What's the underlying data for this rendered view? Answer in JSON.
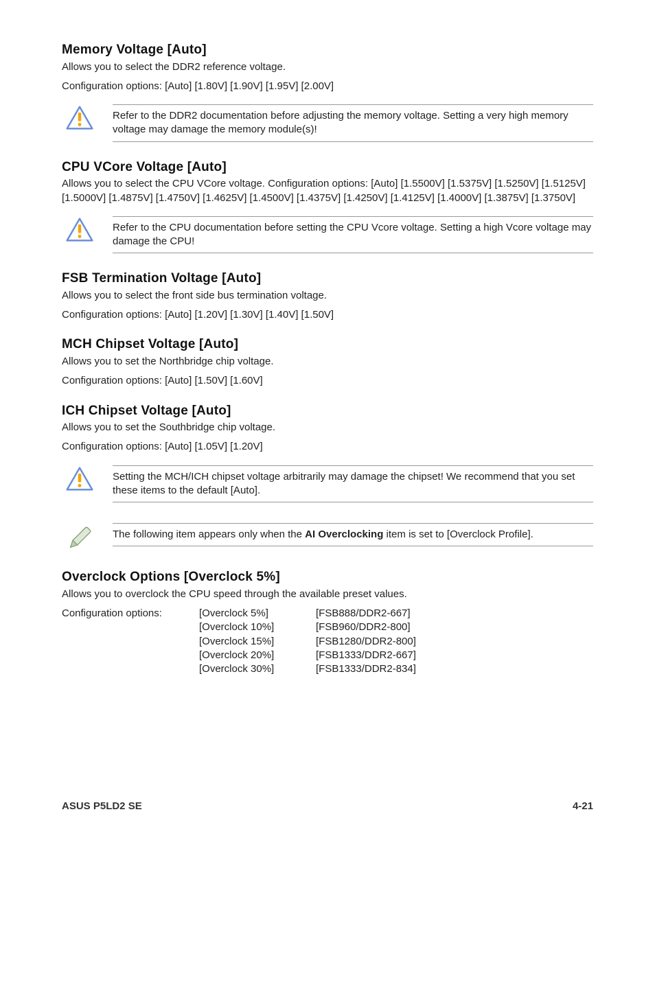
{
  "sections": {
    "memory": {
      "title": "Memory Voltage [Auto]",
      "body1": "Allows you to select the DDR2 reference voltage.",
      "body2": "Configuration options: [Auto] [1.80V] [1.90V] [1.95V] [2.00V]",
      "callout": "Refer to the DDR2 documentation before adjusting the memory voltage. Setting a very high memory voltage may damage the memory module(s)!"
    },
    "cpu": {
      "title": "CPU VCore Voltage [Auto]",
      "body1": "Allows you to select the CPU VCore voltage. Configuration options: [Auto] [1.5500V] [1.5375V] [1.5250V] [1.5125V] [1.5000V] [1.4875V] [1.4750V] [1.4625V] [1.4500V] [1.4375V] [1.4250V] [1.4125V] [1.4000V] [1.3875V] [1.3750V]",
      "callout": "Refer to the CPU documentation before setting the CPU Vcore voltage. Setting a high Vcore voltage may damage the CPU!"
    },
    "fsb": {
      "title": "FSB Termination Voltage [Auto]",
      "body1": "Allows you to select the front side bus termination voltage.",
      "body2": "Configuration options: [Auto] [1.20V] [1.30V] [1.40V] [1.50V]"
    },
    "mch": {
      "title": "MCH Chipset Voltage [Auto]",
      "body1": "Allows you to set the Northbridge chip voltage.",
      "body2": "Configuration options: [Auto] [1.50V] [1.60V]"
    },
    "ich": {
      "title": "ICH Chipset Voltage [Auto]",
      "body1": "Allows you to set the Southbridge chip voltage.",
      "body2": "Configuration options: [Auto] [1.05V] [1.20V]",
      "callout_warn": "Setting the MCH/ICH chipset voltage arbitrarily may damage the chipset! We recommend that you set these items to the default [Auto].",
      "callout_note_pre": "The following item appears only when the ",
      "callout_note_bold": "AI Overclocking",
      "callout_note_post": " item is set to [Overclock Profile]."
    },
    "overclock": {
      "title": "Overclock Options [Overclock 5%]",
      "body1": "Allows you to overclock the CPU speed through the available preset values.",
      "table_label": "Configuration options:",
      "rows": [
        {
          "c1": "[Overclock   5%]",
          "c2": "[FSB888/DDR2-667]"
        },
        {
          "c1": "[Overclock 10%]",
          "c2": "[FSB960/DDR2-800]"
        },
        {
          "c1": "[Overclock 15%]",
          "c2": "[FSB1280/DDR2-800]"
        },
        {
          "c1": "[Overclock 20%]",
          "c2": "[FSB1333/DDR2-667]"
        },
        {
          "c1": "[Overclock 30%]",
          "c2": "[FSB1333/DDR2-834]"
        }
      ]
    }
  },
  "footer": {
    "left": "ASUS P5LD2 SE",
    "right": "4-21"
  }
}
